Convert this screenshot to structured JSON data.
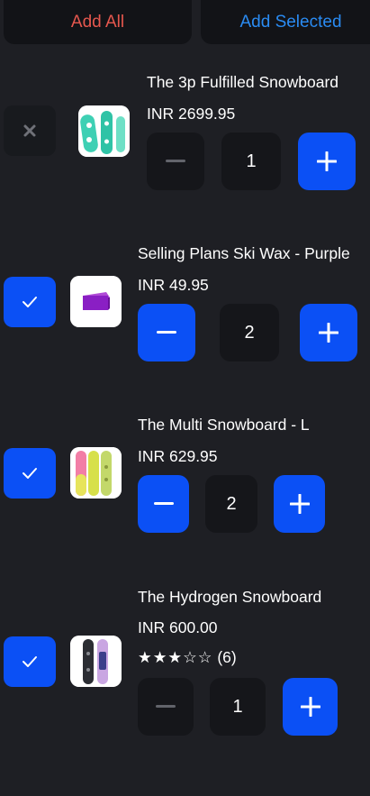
{
  "header": {
    "add_all_label": "Add All",
    "add_selected_label": "Add Selected"
  },
  "colors": {
    "accent_blue": "#0b50f5",
    "add_all_red": "#e5574e",
    "add_selected_blue": "#2a8bf2",
    "background": "#1e1f24"
  },
  "items": [
    {
      "title": "The 3p Fulfilled Snowboard",
      "price": "INR 2699.95",
      "quantity": "1",
      "selected": false,
      "checkbox_icon": "x-icon",
      "thumb_icon": "teal-snowboard-icon"
    },
    {
      "title": "Selling Plans Ski Wax - Purple",
      "price": "INR 49.95",
      "quantity": "2",
      "selected": true,
      "checkbox_icon": "checkmark-icon",
      "thumb_icon": "purple-wax-icon"
    },
    {
      "title": "The Multi Snowboard - L",
      "price": "INR 629.95",
      "quantity": "2",
      "selected": true,
      "checkbox_icon": "checkmark-icon",
      "thumb_icon": "pink-yellow-snowboard-icon"
    },
    {
      "title": "The Hydrogen Snowboard",
      "price": "INR 600.00",
      "rating_stars": "★★★☆☆",
      "rating_count": "(6)",
      "rating_value": 3,
      "quantity": "1",
      "selected": true,
      "checkbox_icon": "checkmark-icon",
      "thumb_icon": "k2-snowboards-icon"
    }
  ]
}
